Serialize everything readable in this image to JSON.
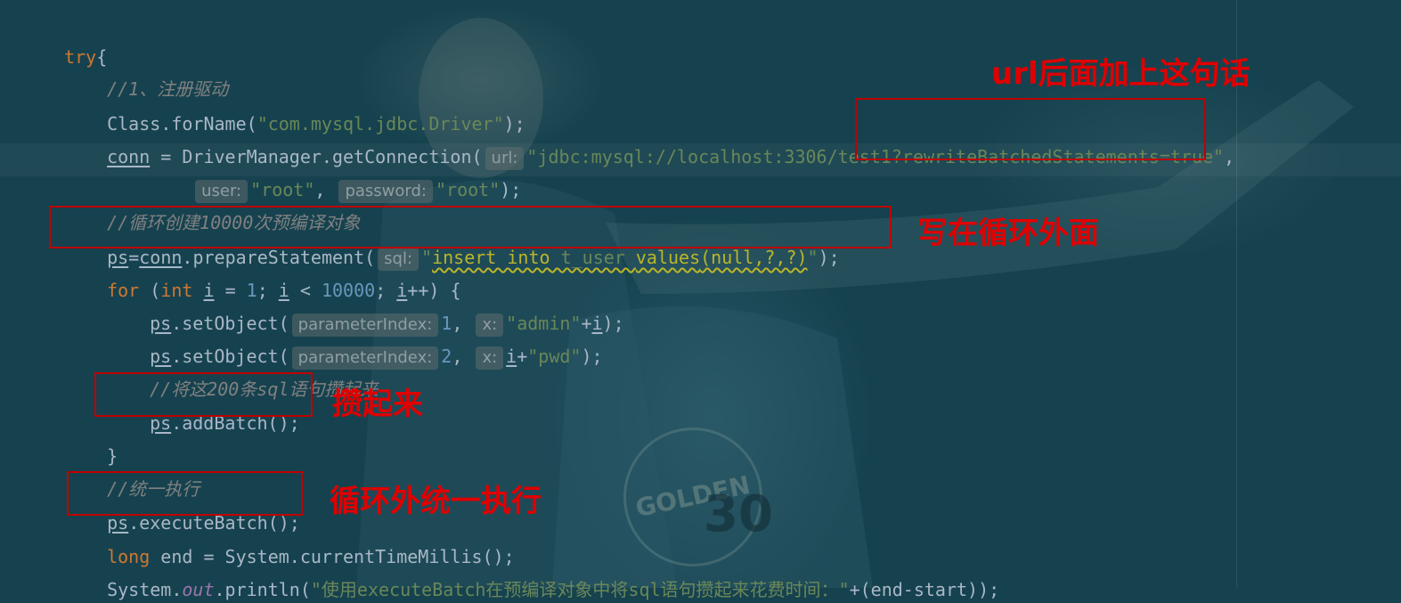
{
  "code": {
    "try": "try",
    "brace_open": "{",
    "brace_close": "}",
    "comment_1": "//1、注册驱动",
    "class_name": "Class",
    "for_name": ".forName(",
    "driver": "\"com.mysql.jdbc.Driver\"",
    "close_semi": ");",
    "conn": "conn",
    "assign": " = ",
    "get_connection": "DriverManager.getConnection(",
    "hint_url": "url:",
    "url_value": "\"jdbc:mysql://localhost:3306/test1?rewriteBatchedStatements=true\"",
    "comma": ",",
    "hint_user": "user:",
    "user_value": "\"root\"",
    "comma_space": ", ",
    "hint_password": "password:",
    "password_value": "\"root\"",
    "comment_2": "//循环创建10000次预编译对象",
    "ps": "ps",
    "eq": "=",
    "prepare": ".prepareStatement(",
    "hint_sql": "sql:",
    "sql_quote_open": "\"",
    "sql_insert": "insert into",
    "sql_table": " t_user ",
    "sql_values": "values",
    "sql_args": "(null,?,?)",
    "sql_quote_close": "\"",
    "for_kw": "for",
    "paren_open": " (",
    "int_kw": "int",
    "i": "i",
    "eq_space": " = ",
    "one": "1",
    "semi_space": "; ",
    "lt": " < ",
    "limit": "10000",
    "incr": "++) {",
    "set_object": ".setObject(",
    "hint_param_index": "parameterIndex:",
    "idx_1": "1",
    "idx_2": "2",
    "hint_x": "x:",
    "admin": "\"admin\"",
    "plus": "+",
    "pwd": "\"pwd\"",
    "comment_3": "//将这200条sql语句攒起来",
    "add_batch": ".addBatch();",
    "comment_4": "//统一执行",
    "execute_batch": ".executeBatch();",
    "long_kw": "long",
    "end_assign": " end = System.currentTimeMillis();",
    "system": "System.",
    "out": "out",
    "println": ".println(",
    "println_str": "\"使用executeBatch在预编译对象中将sql语句攒起来花费时间：\"",
    "println_tail": "+(end-start));"
  },
  "annotations": {
    "url_note": "url后面加上这句话",
    "outside_loop": "写在循环外面",
    "batch_up": "攒起来",
    "execute_outside": "循环外统一执行"
  },
  "colors": {
    "keyword": "#cc7832",
    "string": "#6a8759",
    "number": "#6897bb",
    "comment": "#808080",
    "annotation_red": "#e00000"
  }
}
